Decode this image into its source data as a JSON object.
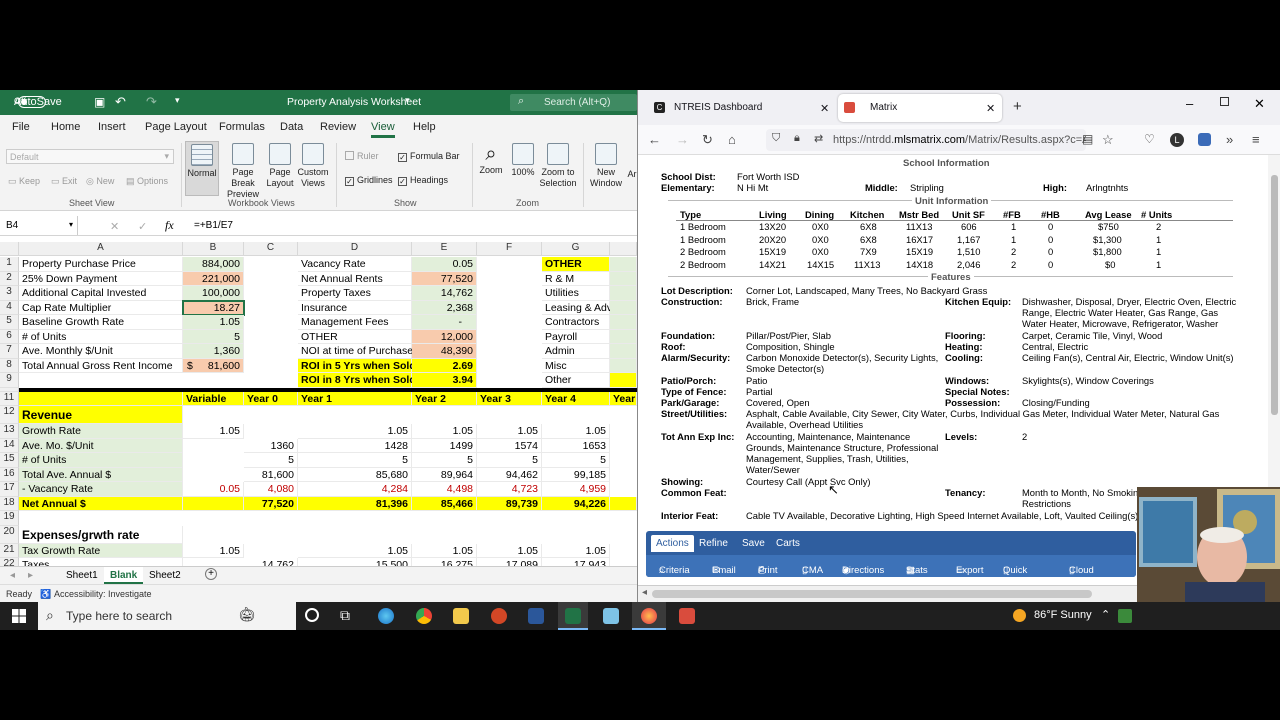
{
  "excel": {
    "autosave_label": "AutoSave",
    "autosave_state": "Off",
    "title": "Property Analysis Worksheet",
    "search_placeholder": "Search (Alt+Q)",
    "menu_tabs": [
      "File",
      "Home",
      "Insert",
      "Page Layout",
      "Formulas",
      "Data",
      "Review",
      "View",
      "Help"
    ],
    "active_tab": "View",
    "ribbon": {
      "sheet_view_default": "Default",
      "keep": "Keep",
      "exit": "Exit",
      "new": "New",
      "options": "Options",
      "sheet_view_group": "Sheet View",
      "normal": "Normal",
      "page_break": "Page Break",
      "preview": "Preview",
      "page_layout_1": "Page",
      "page_layout_2": "Layout",
      "custom_views_1": "Custom",
      "custom_views_2": "Views",
      "workbook_views_group": "Workbook Views",
      "ruler": "Ruler",
      "formula_bar": "Formula Bar",
      "gridlines": "Gridlines",
      "headings": "Headings",
      "show_group": "Show",
      "zoom": "Zoom",
      "zoom100": "100%",
      "zoom_sel_1": "Zoom to",
      "zoom_sel_2": "Selection",
      "zoom_group": "Zoom",
      "new_window_1": "New",
      "new_window_2": "Window",
      "arrange_trunc": "Ar"
    },
    "name_box": "B4",
    "formula": "=+B1/E7",
    "columns": [
      "A",
      "B",
      "C",
      "D",
      "E",
      "F",
      "G"
    ],
    "rows": {
      "r1": {
        "a": "Property Purchase Price",
        "b": "884,000",
        "d": "Vacancy Rate",
        "e": "0.05",
        "g": "OTHER"
      },
      "r2": {
        "a": "25% Down Payment",
        "b": "221,000",
        "d": "Net Annual Rents",
        "e": "77,520",
        "g": "R & M"
      },
      "r3": {
        "a": "Additional Capital Invested",
        "b": "100,000",
        "d": "Property Taxes",
        "e": "14,762",
        "g": "Utilities"
      },
      "r4": {
        "a": "Cap Rate Multiplier",
        "b": "18.27",
        "d": "Insurance",
        "e": "2,368",
        "g": "Leasing & Adv"
      },
      "r5": {
        "a": "Baseline Growth Rate",
        "b": "1.05",
        "d": "Management Fees",
        "e": "-",
        "g": "Contractors"
      },
      "r6": {
        "a": "# of Units",
        "b": "5",
        "d": "OTHER",
        "e": "12,000",
        "g": "Payroll"
      },
      "r7": {
        "a": "Ave. Monthly $/Unit",
        "b": "1,360",
        "d": "NOI at time of Purchase",
        "e": "48,390",
        "g": "Admin"
      },
      "r8": {
        "a": "Total Annual Gross Rent Income",
        "b_cur": "$",
        "b": "81,600",
        "d": "ROI in 5 Yrs when Sold",
        "e": "2.69",
        "g": "Misc"
      },
      "r9": {
        "d": "ROI in 8 Yrs when Sold",
        "e": "3.94",
        "g": "Other"
      },
      "r11": {
        "b": "Variable",
        "c": "Year 0",
        "d": "Year 1",
        "e": "Year 2",
        "f": "Year 3",
        "g": "Year 4",
        "h": "Year"
      },
      "r12": {
        "a": "Revenue"
      },
      "r13": {
        "a": "Growth Rate",
        "b": "1.05",
        "d": "1.05",
        "e": "1.05",
        "f": "1.05",
        "g": "1.05"
      },
      "r14": {
        "a": "Ave. Mo. $/Unit",
        "c": "1360",
        "d": "1428",
        "e": "1499",
        "f": "1574",
        "g": "1653"
      },
      "r15": {
        "a": "# of Units",
        "c": "5",
        "d": "5",
        "e": "5",
        "f": "5",
        "g": "5"
      },
      "r16": {
        "a": "Total Ave. Annual $",
        "c": "81,600",
        "d": "85,680",
        "e": "89,964",
        "f": "94,462",
        "g": "99,185"
      },
      "r17": {
        "a": " - Vacancy Rate",
        "b": "0.05",
        "c": "4,080",
        "d": "4,284",
        "e": "4,498",
        "f": "4,723",
        "g": "4,959"
      },
      "r18": {
        "a": "Net Annual $",
        "c": "77,520",
        "d": "81,396",
        "e": "85,466",
        "f": "89,739",
        "g": "94,226"
      },
      "r20": {
        "a": "Expenses/grwth rate"
      },
      "r21": {
        "a": "Tax Growth Rate",
        "b": "1.05",
        "d": "1.05",
        "e": "1.05",
        "f": "1.05",
        "g": "1.05"
      },
      "r22": {
        "a": "Taxes",
        "c": "14,762",
        "d": "15,500",
        "e": "16,275",
        "f": "17,089",
        "g": "17,943"
      }
    },
    "sheets": [
      "Sheet1",
      "Blank",
      "Sheet2"
    ],
    "active_sheet": "Blank",
    "status_ready": "Ready",
    "status_accessibility": "Accessibility: Investigate"
  },
  "firefox": {
    "tabs": [
      {
        "label": "NTREIS Dashboard"
      },
      {
        "label": "Matrix"
      }
    ],
    "url_prefix": "https://ntrdd.",
    "url_domain": "mlsmatrix.com",
    "url_path": "/Matrix/Results.aspx?c=A",
    "page": {
      "school_header": "School Information",
      "school_dist_label": "School Dist:",
      "school_dist": "Fort Worth ISD",
      "elementary_label": "Elementary:",
      "elementary": "N Hi Mt",
      "middle_label": "Middle:",
      "middle": "Stripling",
      "high_label": "High:",
      "high": "Arlngtnhts",
      "unit_header": "Unit Information",
      "unit_cols": [
        "Type",
        "Living",
        "Dining",
        "Kitchen",
        "Mstr Bed",
        "Unit SF",
        "#FB",
        "#HB",
        "Avg Lease",
        "# Units"
      ],
      "unit_rows": [
        [
          "1 Bedroom",
          "13X20",
          "0X0",
          "6X8",
          "11X13",
          "606",
          "1",
          "0",
          "$750",
          "2"
        ],
        [
          "1 Bedroom",
          "20X20",
          "0X0",
          "6X8",
          "16X17",
          "1,167",
          "1",
          "0",
          "$1,300",
          "1"
        ],
        [
          "2 Bedroom",
          "15X19",
          "0X0",
          "7X9",
          "15X19",
          "1,510",
          "2",
          "0",
          "$1,800",
          "1"
        ],
        [
          "2 Bedroom",
          "14X21",
          "14X15",
          "11X13",
          "14X18",
          "2,046",
          "2",
          "0",
          "$0",
          "1"
        ]
      ],
      "features_header": "Features",
      "lot_label": "Lot Description:",
      "lot": "Corner Lot, Landscaped, Many Trees, No Backyard Grass",
      "construction_label": "Construction:",
      "construction": "Brick, Frame",
      "kitchen_label": "Kitchen Equip:",
      "kitchen_1": "Dishwasher, Disposal, Dryer, Electric Oven, Electric",
      "kitchen_2": "Range, Electric Water Heater, Gas Range, Gas",
      "kitchen_3": "Water Heater, Microwave, Refrigerator, Washer",
      "foundation_label": "Foundation:",
      "foundation": "Pillar/Post/Pier, Slab",
      "flooring_label": "Flooring:",
      "flooring": "Carpet, Ceramic Tile, Vinyl, Wood",
      "roof_label": "Roof:",
      "roof": "Composition, Shingle",
      "heating_label": "Heating:",
      "heating": "Central, Electric",
      "alarm_label": "Alarm/Security:",
      "alarm_1": "Carbon Monoxide Detector(s), Security Lights,",
      "alarm_2": "Smoke Detector(s)",
      "cooling_label": "Cooling:",
      "cooling": "Ceiling Fan(s), Central Air, Electric, Window Unit(s)",
      "patio_label": "Patio/Porch:",
      "patio": "Patio",
      "windows_label": "Windows:",
      "windows": "Skylights(s), Window Coverings",
      "fence_label": "Type of Fence:",
      "fence": "Partial",
      "special_label": "Special Notes:",
      "park_label": "Park/Garage:",
      "park": "Covered, Open",
      "possession_label": "Possession:",
      "possession": "Closing/Funding",
      "street_label": "Street/Utilities:",
      "street_1": "Asphalt, Cable Available, City Sewer, City Water, Curbs, Individual Gas Meter, Individual Water Meter, Natural Gas",
      "street_2": "Available, Overhead Utilities",
      "totann_label": "Tot Ann Exp Inc:",
      "totann_1": "Accounting, Maintenance, Maintenance",
      "totann_2": "Grounds, Maintenance Structure, Professional",
      "totann_3": "Management, Supplies, Trash, Utilities,",
      "totann_4": "Water/Sewer",
      "levels_label": "Levels:",
      "levels": "2",
      "showing_label": "Showing:",
      "showing": "Courtesy Call (Appt Svc Only)",
      "common_label": "Common Feat:",
      "tenancy_label": "Tenancy:",
      "tenancy_1": "Month to Month, No Smokin",
      "tenancy_2": "Restrictions",
      "interior_label": "Interior Feat:",
      "interior": "Cable TV Available, Decorative Lighting, High Speed Internet Available, Loft, Vaulted Ceiling(s)"
    },
    "matrix_tabs": [
      "Actions",
      "Refine",
      "Save",
      "Carts"
    ],
    "matrix_buttons": [
      "Criteria",
      "Email",
      "Print",
      "CMA",
      "Directions",
      "Stats",
      "Export",
      "Quick CMA",
      "Cloud CMA"
    ]
  },
  "taskbar": {
    "search_placeholder": "Type here to search",
    "weather": "86°F  Sunny"
  }
}
